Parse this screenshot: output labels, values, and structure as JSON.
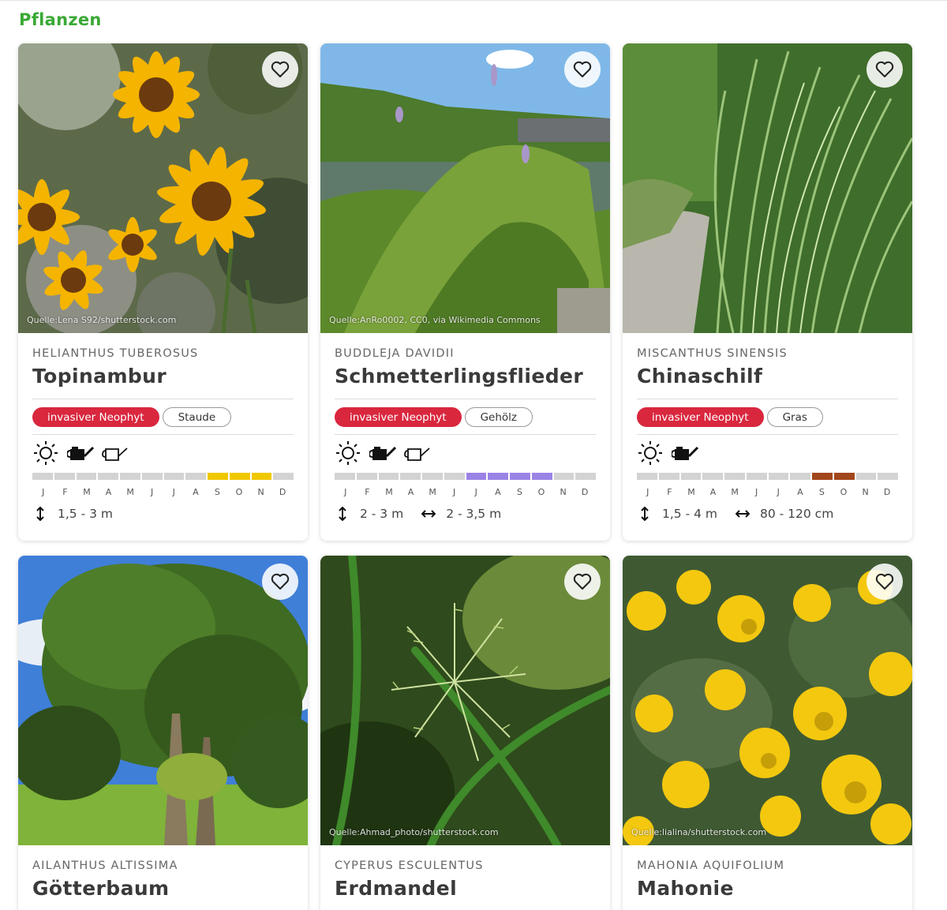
{
  "page": {
    "title": "Pflanzen"
  },
  "month_letters": [
    "J",
    "F",
    "M",
    "A",
    "M",
    "J",
    "J",
    "A",
    "S",
    "O",
    "N",
    "D"
  ],
  "cards": [
    {
      "latin": "HELIANTHUS TUBEROSUS",
      "name": "Topinambur",
      "credit": "Quelle:Lena S92/shutterstock.com",
      "tags": [
        "invasiver Neophyt",
        "Staude"
      ],
      "icons": [
        "sun-icon",
        "watering-can-filled-icon",
        "watering-can-outline-icon"
      ],
      "bloom_months": [
        8,
        9,
        10
      ],
      "bloom_color": "#f0c800",
      "height": "1,5 - 3 m",
      "width": ""
    },
    {
      "latin": "BUDDLEJA DAVIDII",
      "name": "Schmetterlingsflieder",
      "credit": "Quelle:AnRo0002, CC0, via Wikimedia Commons",
      "tags": [
        "invasiver Neophyt",
        "Gehölz"
      ],
      "icons": [
        "sun-icon",
        "watering-can-filled-icon",
        "watering-can-outline-icon"
      ],
      "bloom_months": [
        6,
        7,
        8,
        9
      ],
      "bloom_color": "#9b82e6",
      "height": "2 - 3 m",
      "width": "2 - 3,5 m"
    },
    {
      "latin": "MISCANTHUS SINENSIS",
      "name": "Chinaschilf",
      "credit": "",
      "tags": [
        "invasiver Neophyt",
        "Gras"
      ],
      "icons": [
        "sun-icon",
        "watering-can-filled-icon"
      ],
      "bloom_months": [
        8,
        9
      ],
      "bloom_color": "#a2461b",
      "height": "1,5 - 4 m",
      "width": "80 - 120 cm"
    },
    {
      "latin": "AILANTHUS ALTISSIMA",
      "name": "Götterbaum",
      "credit": ""
    },
    {
      "latin": "CYPERUS ESCULENTUS",
      "name": "Erdmandel",
      "credit": "Quelle:Ahmad_photo/shutterstock.com"
    },
    {
      "latin": "MAHONIA AQUIFOLIUM",
      "name": "Mahonie",
      "credit": "Quelle:lialina/shutterstock.com"
    }
  ]
}
